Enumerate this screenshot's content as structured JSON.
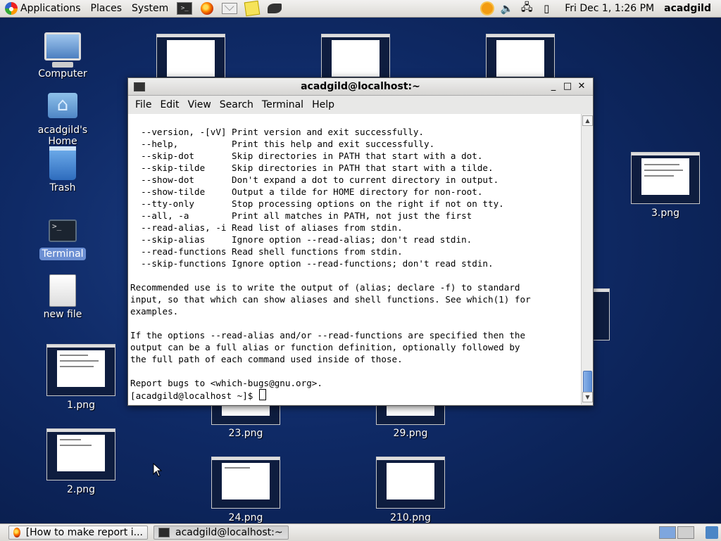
{
  "top_panel": {
    "menus": [
      "Applications",
      "Places",
      "System"
    ],
    "launchers": [
      "terminal-icon",
      "firefox-icon",
      "mail-icon",
      "notes-icon",
      "dolphin-icon"
    ],
    "clock": "Fri Dec  1,  1:26 PM",
    "user": "acadgild"
  },
  "desktop": {
    "icons": [
      {
        "label": "Computer",
        "icon": "computer-icon"
      },
      {
        "label": "acadgild's Home",
        "icon": "home-folder-icon"
      },
      {
        "label": "Trash",
        "icon": "trash-icon"
      },
      {
        "label": "Terminal",
        "icon": "terminal-icon",
        "selected": true
      },
      {
        "label": "new file",
        "icon": "file-icon"
      }
    ],
    "thumbnails": [
      "1.png",
      "2.png",
      "3.png",
      "23.png",
      "29.png",
      "24.png",
      "210.png"
    ]
  },
  "window": {
    "title": "acadgild@localhost:~",
    "menu": [
      "File",
      "Edit",
      "View",
      "Search",
      "Terminal",
      "Help"
    ],
    "lines": [
      "  --version, -[vV] Print version and exit successfully.",
      "  --help,          Print this help and exit successfully.",
      "  --skip-dot       Skip directories in PATH that start with a dot.",
      "  --skip-tilde     Skip directories in PATH that start with a tilde.",
      "  --show-dot       Don't expand a dot to current directory in output.",
      "  --show-tilde     Output a tilde for HOME directory for non-root.",
      "  --tty-only       Stop processing options on the right if not on tty.",
      "  --all, -a        Print all matches in PATH, not just the first",
      "  --read-alias, -i Read list of aliases from stdin.",
      "  --skip-alias     Ignore option --read-alias; don't read stdin.",
      "  --read-functions Read shell functions from stdin.",
      "  --skip-functions Ignore option --read-functions; don't read stdin.",
      "",
      "Recommended use is to write the output of (alias; declare -f) to standard",
      "input, so that which can show aliases and shell functions. See which(1) for",
      "examples.",
      "",
      "If the options --read-alias and/or --read-functions are specified then the",
      "output can be a full alias or function definition, optionally followed by",
      "the full path of each command used inside of those.",
      "",
      "Report bugs to <which-bugs@gnu.org>."
    ],
    "prompt": "[acadgild@localhost ~]$ "
  },
  "taskbar": {
    "tasks": [
      {
        "label": "[How to make report i...",
        "icon": "firefox-icon"
      },
      {
        "label": "acadgild@localhost:~",
        "icon": "terminal-icon",
        "active": true
      }
    ]
  }
}
